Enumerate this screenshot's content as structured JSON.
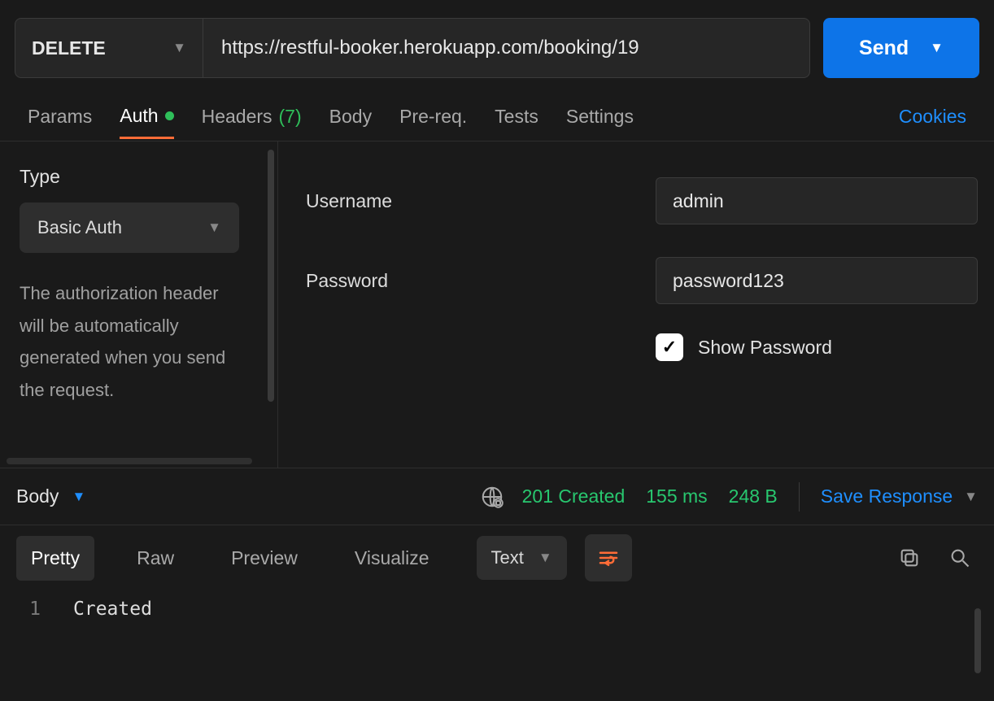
{
  "request": {
    "method": "DELETE",
    "url": "https://restful-booker.herokuapp.com/booking/19",
    "send_label": "Send"
  },
  "tabs": {
    "params": "Params",
    "auth": "Auth",
    "headers_label": "Headers",
    "headers_count": "(7)",
    "body": "Body",
    "prereq": "Pre-req.",
    "tests": "Tests",
    "settings": "Settings",
    "cookies": "Cookies"
  },
  "auth": {
    "type_label": "Type",
    "type_value": "Basic Auth",
    "description": "The authorization header will be automatically generated when you send the request.",
    "username_label": "Username",
    "username_value": "admin",
    "password_label": "Password",
    "password_value": "password123",
    "show_password_label": "Show Password"
  },
  "response_meta": {
    "body_label": "Body",
    "status": "201 Created",
    "time": "155 ms",
    "size": "248 B",
    "save_label": "Save Response"
  },
  "response_views": {
    "pretty": "Pretty",
    "raw": "Raw",
    "preview": "Preview",
    "visualize": "Visualize",
    "format": "Text"
  },
  "response_body": {
    "line_number": "1",
    "content": "Created"
  }
}
